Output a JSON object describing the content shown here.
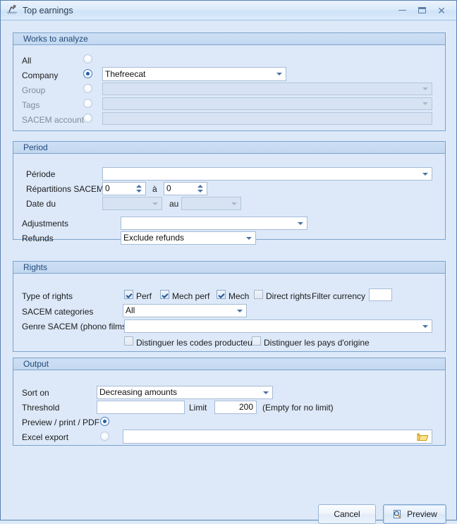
{
  "window": {
    "title": "Top earnings",
    "icon": "report-chart-icon",
    "controls": {
      "minimize": "minimize-icon",
      "maximize": "maximize-icon",
      "close": "close-icon"
    }
  },
  "groups": {
    "works": {
      "title": "Works to analyze",
      "rows": [
        {
          "label": "All",
          "selected": false,
          "field": null
        },
        {
          "label": "Company",
          "selected": true,
          "field": "Thefreecat"
        },
        {
          "label": "Group",
          "selected": false,
          "field": ""
        },
        {
          "label": "Tags",
          "selected": false,
          "field": ""
        },
        {
          "label": "SACEM account",
          "selected": false,
          "field": ""
        }
      ]
    },
    "period": {
      "title": "Period",
      "periode_label": "Période",
      "periode_value": "",
      "repartitions_label": "Répartitions SACEM",
      "repartitions_from": "0",
      "repartitions_sep": "à",
      "repartitions_to": "0",
      "date_label": "Date du",
      "date_from": "",
      "date_sep": "au",
      "date_to": "",
      "adjustments_label": "Adjustments",
      "adjustments_value": "",
      "refunds_label": "Refunds",
      "refunds_value": "Exclude refunds"
    },
    "rights": {
      "title": "Rights",
      "type_label": "Type of rights",
      "checks": [
        {
          "label": "Perf",
          "checked": true
        },
        {
          "label": "Mech perf",
          "checked": true
        },
        {
          "label": "Mech",
          "checked": true
        },
        {
          "label": "Direct rights",
          "checked": false
        }
      ],
      "filter_currency_label": "Filter currency",
      "filter_currency_value": "",
      "categories_label": "SACEM categories",
      "categories_value": "All",
      "genre_label": "Genre SACEM (phono films)",
      "genre_value": "",
      "distinguish": [
        {
          "label": "Distinguer les codes producteur",
          "checked": false
        },
        {
          "label": "Distinguer les pays d'origine",
          "checked": false
        }
      ]
    },
    "output": {
      "title": "Output",
      "sort_label": "Sort on",
      "sort_value": "Decreasing amounts",
      "threshold_label": "Threshold",
      "threshold_value": "",
      "limit_label": "Limit",
      "limit_value": "200",
      "limit_hint": "(Empty for no limit)",
      "preview_label": "Preview / print / PDF",
      "preview_selected": true,
      "excel_label": "Excel export",
      "excel_selected": false,
      "excel_path": "",
      "browse_icon": "folder-open-icon"
    }
  },
  "footer": {
    "cancel_label": "Cancel",
    "preview_label": "Preview",
    "preview_icon": "magnifier-page-icon"
  },
  "colors": {
    "background": "#dde9f9",
    "group_border": "#7da2cd",
    "header_text": "#214a7b",
    "accent": "#1f5fa8"
  }
}
